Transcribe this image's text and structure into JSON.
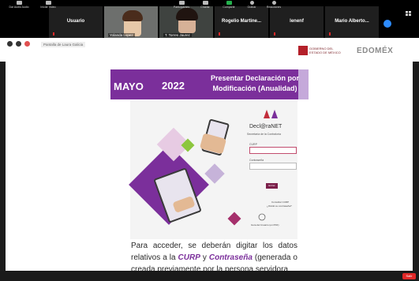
{
  "participants": [
    {
      "name": "",
      "caption": "Yolanda Lopez",
      "video": true
    },
    {
      "name": "",
      "caption": "T. Torres Jaurez",
      "video": true
    },
    {
      "name": "Usuario",
      "caption": ""
    },
    {
      "name": "Rogelio Martine...",
      "caption": ""
    },
    {
      "name": "lenenf",
      "caption": ""
    },
    {
      "name": "Mario Alberto...",
      "caption": ""
    }
  ],
  "share_label": "Pantalla de Laura Galicia",
  "logos": {
    "gobierno_line1": "GOBIERNO DEL",
    "gobierno_line2": "ESTADO DE MÉXICO",
    "edomex": "EDOMÉX"
  },
  "banner": {
    "month": "MAYO",
    "year": "2022",
    "subtitle": "Presentar Declaración por Modificación (Anualidad)"
  },
  "poster": {
    "app_name": "Decl@raNET",
    "app_sub": "Secretaría de la Contraloría",
    "curp_label": "CURP",
    "password_label": "Contraseña",
    "button": "Entrar",
    "link1": "Consultar CURP",
    "link2": "¿Olvidó su contraseña?",
    "link3": "Guía del Usuario (en PDF)"
  },
  "body_text": {
    "before": "Para acceder, se deberán digitar los datos relativos a la ",
    "curp": "CURP",
    "and": " y ",
    "pass": "Contraseña",
    "after": " (generada o creada previamente por la persona servidora"
  },
  "toolbar": {
    "mute": "Dar Audio Audio",
    "video": "Iniciar Video",
    "participants": "Participantes",
    "chat": "Charlar",
    "share": "Compartir",
    "record": "Grabar",
    "reactions": "Reacciones",
    "end": "Salir"
  },
  "colors": {
    "banner_purple": "#7b2f9b",
    "share_green": "#24b14d",
    "end_red": "#e02828",
    "zoom_blue": "#2d8cff"
  }
}
